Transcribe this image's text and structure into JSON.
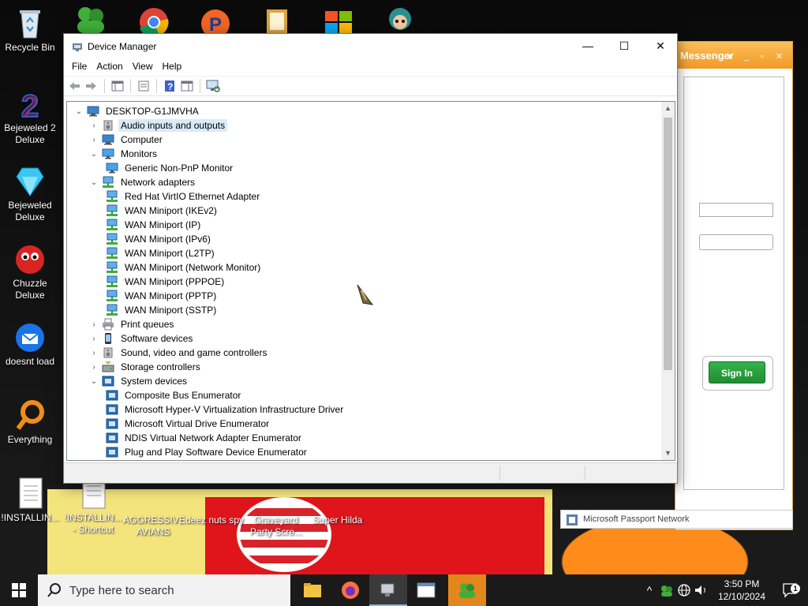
{
  "desktop": {
    "icons": [
      {
        "label": "Recycle Bin",
        "icon": "recycle-bin-icon"
      },
      {
        "label": "Bejeweled 2 Deluxe",
        "icon": "bejeweled2-icon"
      },
      {
        "label": "Bejeweled Deluxe",
        "icon": "bejeweled-icon"
      },
      {
        "label": "Chuzzle Deluxe",
        "icon": "chuzzle-icon"
      },
      {
        "label": "doesnt load",
        "icon": "thunderbird-icon"
      },
      {
        "label": "Everything",
        "icon": "everything-icon"
      },
      {
        "label": "!INSTALLIN...",
        "icon": "text-file-icon"
      },
      {
        "label": "!INSTALLIN... - Shortcut",
        "icon": "text-file-shortcut-icon"
      },
      {
        "label": "AGGRESSIVE AVIANS",
        "icon": "app-icon"
      },
      {
        "label": "deez nuts spy",
        "icon": "app-icon"
      },
      {
        "label": "Graveyard Party Scre...",
        "icon": "app-icon"
      },
      {
        "label": "Super Hilda",
        "icon": "app-icon"
      }
    ]
  },
  "messenger": {
    "title": "Messenger",
    "signin_label": "Sign In",
    "passport_label": "Microsoft Passport Network"
  },
  "device_manager": {
    "title": "Device Manager",
    "menu": [
      "File",
      "Action",
      "View",
      "Help"
    ],
    "tree": [
      {
        "level": 0,
        "expander": "expanded",
        "icon": "computer-icon",
        "label": "DESKTOP-G1JMVHA"
      },
      {
        "level": 1,
        "expander": "collapsed",
        "icon": "speaker-icon",
        "label": "Audio inputs and outputs",
        "selected": true
      },
      {
        "level": 1,
        "expander": "collapsed",
        "icon": "computer-icon",
        "label": "Computer"
      },
      {
        "level": 1,
        "expander": "expanded",
        "icon": "monitor-icon",
        "label": "Monitors"
      },
      {
        "level": 2,
        "expander": "none",
        "icon": "monitor-icon",
        "label": "Generic Non-PnP Monitor"
      },
      {
        "level": 1,
        "expander": "expanded",
        "icon": "network-icon",
        "label": "Network adapters"
      },
      {
        "level": 2,
        "expander": "none",
        "icon": "network-icon",
        "label": "Red Hat VirtIO Ethernet Adapter"
      },
      {
        "level": 2,
        "expander": "none",
        "icon": "network-icon",
        "label": "WAN Miniport (IKEv2)"
      },
      {
        "level": 2,
        "expander": "none",
        "icon": "network-icon",
        "label": "WAN Miniport (IP)"
      },
      {
        "level": 2,
        "expander": "none",
        "icon": "network-icon",
        "label": "WAN Miniport (IPv6)"
      },
      {
        "level": 2,
        "expander": "none",
        "icon": "network-icon",
        "label": "WAN Miniport (L2TP)"
      },
      {
        "level": 2,
        "expander": "none",
        "icon": "network-icon",
        "label": "WAN Miniport (Network Monitor)"
      },
      {
        "level": 2,
        "expander": "none",
        "icon": "network-icon",
        "label": "WAN Miniport (PPPOE)"
      },
      {
        "level": 2,
        "expander": "none",
        "icon": "network-icon",
        "label": "WAN Miniport (PPTP)"
      },
      {
        "level": 2,
        "expander": "none",
        "icon": "network-icon",
        "label": "WAN Miniport (SSTP)"
      },
      {
        "level": 1,
        "expander": "collapsed",
        "icon": "printer-icon",
        "label": "Print queues"
      },
      {
        "level": 1,
        "expander": "collapsed",
        "icon": "phone-icon",
        "label": "Software devices"
      },
      {
        "level": 1,
        "expander": "collapsed",
        "icon": "speaker-icon",
        "label": "Sound, video and game controllers"
      },
      {
        "level": 1,
        "expander": "collapsed",
        "icon": "storage-icon",
        "label": "Storage controllers"
      },
      {
        "level": 1,
        "expander": "expanded",
        "icon": "system-device-icon",
        "label": "System devices"
      },
      {
        "level": 2,
        "expander": "none",
        "icon": "system-device-icon",
        "label": "Composite Bus Enumerator"
      },
      {
        "level": 2,
        "expander": "none",
        "icon": "system-device-icon",
        "label": "Microsoft Hyper-V Virtualization Infrastructure Driver"
      },
      {
        "level": 2,
        "expander": "none",
        "icon": "system-device-icon",
        "label": "Microsoft Virtual Drive Enumerator"
      },
      {
        "level": 2,
        "expander": "none",
        "icon": "system-device-icon",
        "label": "NDIS Virtual Network Adapter Enumerator"
      },
      {
        "level": 2,
        "expander": "none",
        "icon": "system-device-icon",
        "label": "Plug and Play Software Device Enumerator"
      }
    ]
  },
  "taskbar": {
    "search_placeholder": "Type here to search",
    "time": "3:50 PM",
    "date": "12/10/2024",
    "notification_count": "1"
  },
  "colors": {
    "selection": "#d9ebf9",
    "taskbar": "#1a1a1a",
    "accent": "#0078d7"
  }
}
